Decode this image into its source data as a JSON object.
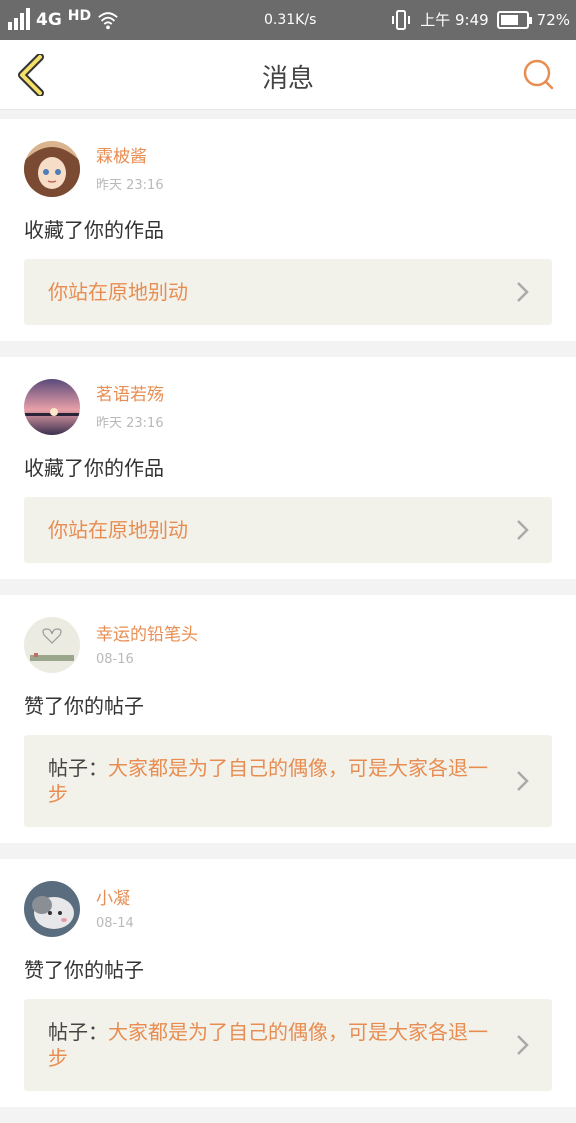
{
  "status": {
    "network": "4G",
    "hd": "HD",
    "speed": "0.31K/s",
    "time": "上午 9:49",
    "battery": "72%",
    "battery_level": 0.72
  },
  "nav": {
    "title": "消息",
    "back_icon": "back-arrow-icon",
    "search_icon": "search-icon"
  },
  "colors": {
    "accent": "#e88d52",
    "card_bg": "#f3f2ea"
  },
  "messages": [
    {
      "user": "霖柀酱",
      "time": "昨天 23:16",
      "action": "收藏了你的作品",
      "prefix": "",
      "target": "你站在原地别动"
    },
    {
      "user": "茗语若殇",
      "time": "昨天 23:16",
      "action": "收藏了你的作品",
      "prefix": "",
      "target": "你站在原地别动"
    },
    {
      "user": "幸运的铅笔头",
      "time": "08-16",
      "action": "赞了你的帖子",
      "prefix": "帖子：",
      "target": "大家都是为了自己的偶像，可是大家各退一步"
    },
    {
      "user": "小凝",
      "time": "08-14",
      "action": "赞了你的帖子",
      "prefix": "帖子：",
      "target": "大家都是为了自己的偶像，可是大家各退一步"
    }
  ]
}
